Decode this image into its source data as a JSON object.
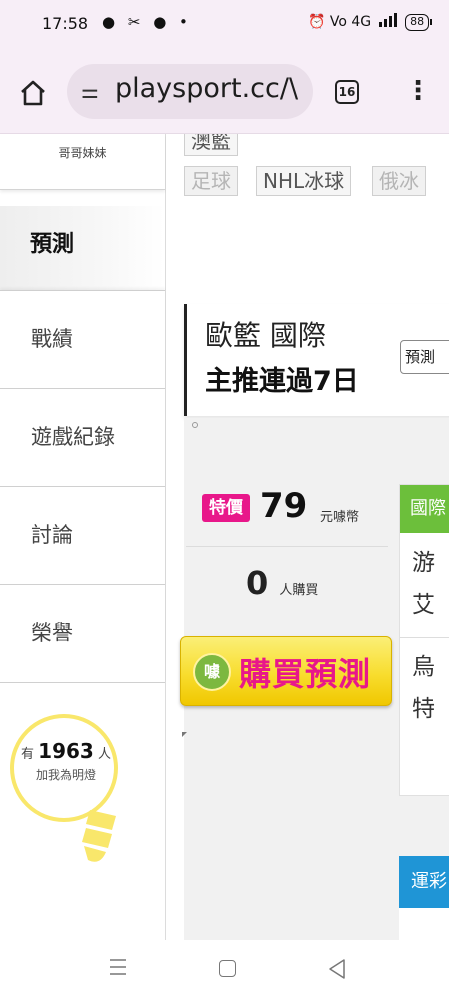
{
  "status_bar": {
    "time": "17:58",
    "left_icons": "● ✂ ● •",
    "right_icons": "⏰ Vo 4G",
    "battery": "88"
  },
  "browser": {
    "url": "playsport.cc/\\",
    "tab_count": "16",
    "icons": [
      "home-icon",
      "site-settings-icon",
      "tabs-icon",
      "more-vert-icon"
    ]
  },
  "sidebar": {
    "user_label": "哥哥妹妹",
    "active_item": "預測",
    "items": [
      "戰績",
      "遊戲紀錄",
      "討論",
      "榮譽"
    ],
    "fans": {
      "prefix": "有",
      "count": "1963",
      "suffix": "人",
      "caption": "加我為明燈"
    }
  },
  "filters": {
    "top_chip": "澳籃",
    "chips": [
      "足球",
      "NHL冰球",
      "俄冰"
    ]
  },
  "prediction": {
    "title": "歐籃 國際",
    "subtitle": "主推連過7日",
    "button": "預測",
    "sale_tag": "特價",
    "price": "79",
    "price_unit": "元噱幣",
    "buyers_count": "0",
    "buyers_label": "人購買",
    "buy_button": "購買預測",
    "coin_glyph": "噱"
  },
  "game": {
    "header": "國際",
    "teams": [
      "游",
      "艾",
      "烏",
      "特"
    ]
  },
  "lottery": {
    "header": "運彩"
  },
  "colors": {
    "sale_pink": "#e8178a",
    "game_green": "#6cbf3b",
    "lottery_blue": "#1f95d6",
    "button_yellow": "#f8dd2e",
    "bulb_yellow": "#f9e76b"
  }
}
